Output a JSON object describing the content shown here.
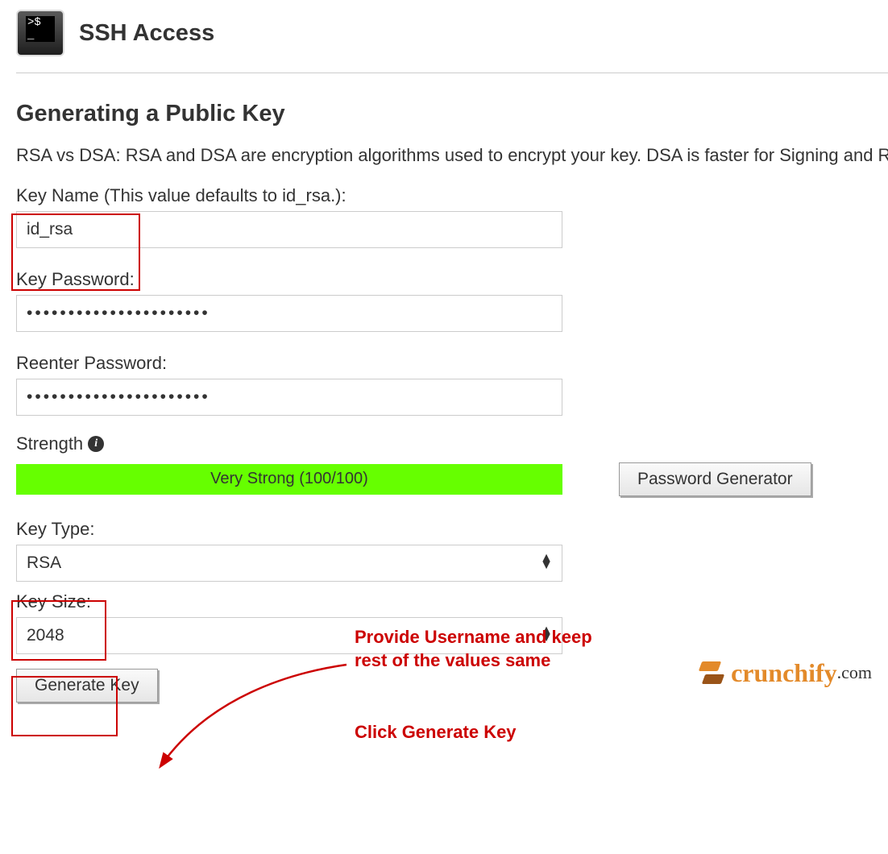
{
  "header": {
    "title": "SSH Access",
    "terminal_prompt": ">$ _"
  },
  "section": {
    "title": "Generating a Public Key",
    "description": "RSA vs DSA: RSA and DSA are encryption algorithms used to encrypt your key. DSA is faster for Signing and RSA is faster for Verification."
  },
  "fields": {
    "key_name": {
      "label": "Key Name (This value defaults to id_rsa.):",
      "value": "id_rsa"
    },
    "key_password": {
      "label": "Key Password:",
      "value": "••••••••••••••••••••••"
    },
    "reenter_password": {
      "label": "Reenter Password:",
      "value": "••••••••••••••••••••••"
    },
    "strength": {
      "label": "Strength",
      "value_text": "Very Strong (100/100)"
    },
    "key_type": {
      "label": "Key Type:",
      "value": "RSA"
    },
    "key_size": {
      "label": "Key Size:",
      "value": "2048"
    }
  },
  "buttons": {
    "password_generator": "Password Generator",
    "generate_key": "Generate Key"
  },
  "annotations": {
    "line1": "Provide Username and keep",
    "line2": "rest of the values same",
    "line3": "Click Generate Key"
  },
  "logo": {
    "brand": "crunchify",
    "suffix": ".com"
  },
  "colors": {
    "highlight": "#cc0000",
    "strength_bar": "#66ff00",
    "brand_orange": "#e38a2a"
  }
}
